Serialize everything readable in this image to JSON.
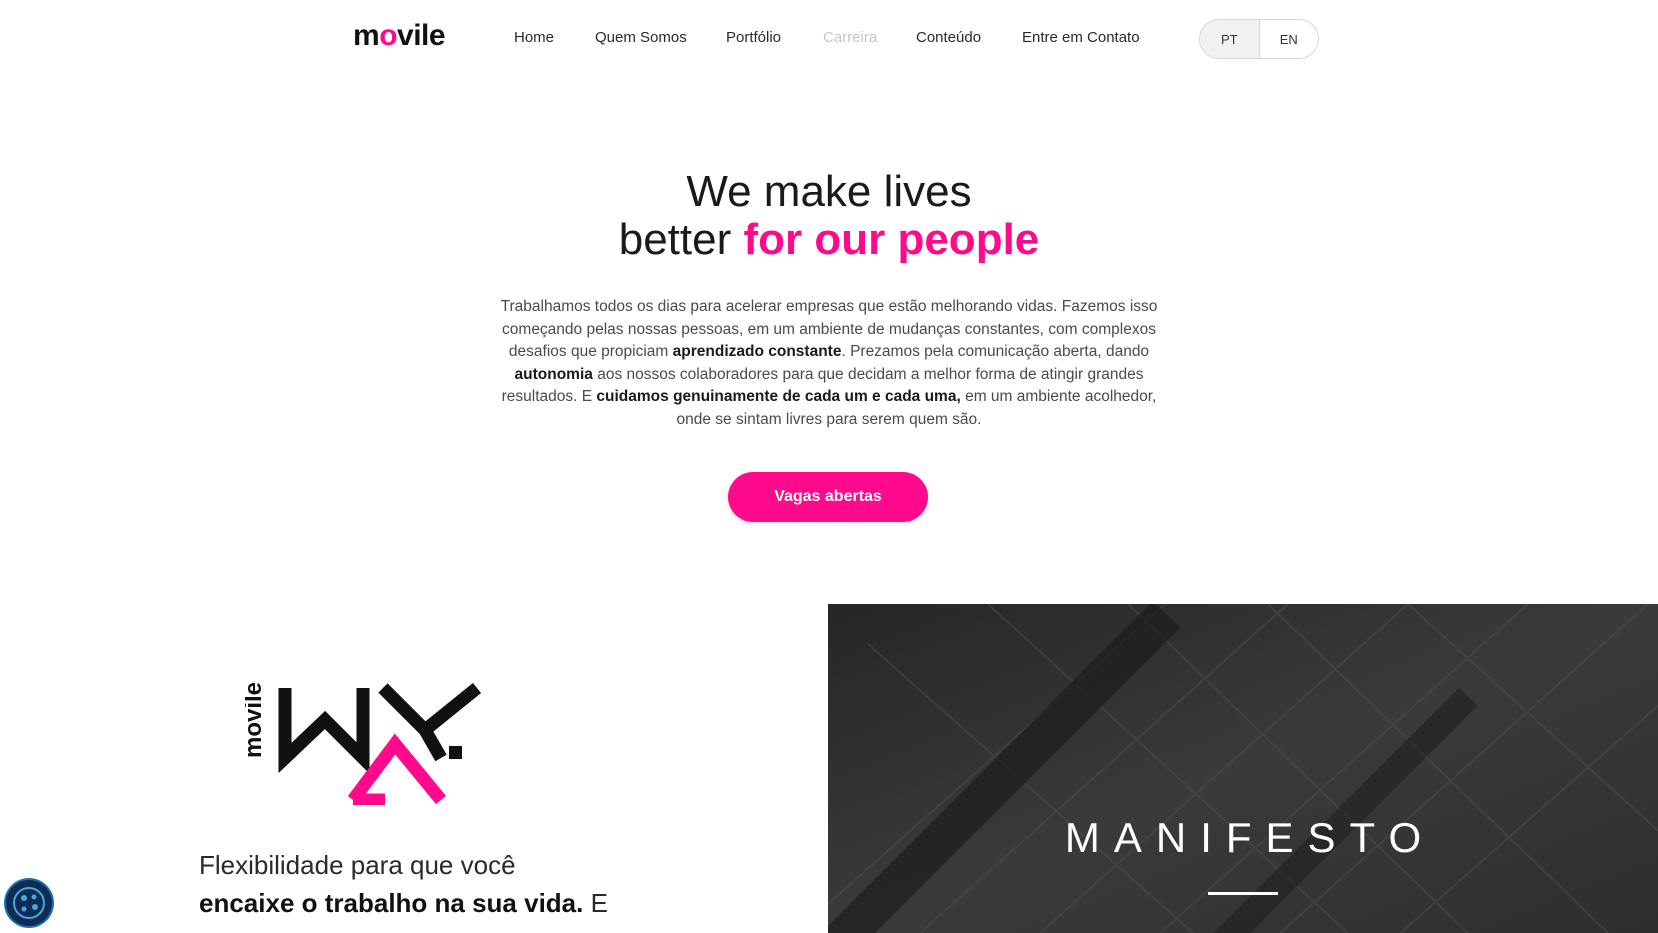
{
  "brand": {
    "logo_pre": "m",
    "logo_o": "o",
    "logo_post": "vile",
    "accent": "#ff0a8c"
  },
  "nav": {
    "items": [
      {
        "label": "Home"
      },
      {
        "label": "Quem Somos"
      },
      {
        "label": "Portfólio"
      },
      {
        "label": "Carreira"
      },
      {
        "label": "Conteúdo"
      },
      {
        "label": "Entre em Contato"
      }
    ],
    "lang_pt": "PT",
    "lang_en": "EN"
  },
  "hero": {
    "title_line1": "We make lives",
    "title_line2_plain": "better ",
    "title_line2_pink": "for our people",
    "p1": "Trabalhamos todos os dias para acelerar empresas que estão melhorando vidas. Fazemos isso começando pelas nossas pessoas, em um ambiente de mudanças constantes, com complexos desafios que propiciam ",
    "b1": "aprendizado constante",
    "p2": ". Prezamos pela comunicação aberta, dando ",
    "b2": "autonomia",
    "p3": " aos nossos colaboradores para que decidam a melhor forma de atingir grandes resultados. E ",
    "b3": "cuidamos genuinamente de cada um e cada uma,",
    "p4": " em um ambiente acolhedor, onde se sintam livres para serem quem são.",
    "cta": "Vagas abertas"
  },
  "way": {
    "logo_side_text": "movile",
    "text_plain": "Flexibilidade para que você ",
    "text_bold": "encaixe o trabalho na sua vida.",
    "text_tail": " E"
  },
  "manifesto": {
    "title": "MANIFESTO"
  },
  "icons": {
    "cookie": "cookie-settings-icon"
  }
}
